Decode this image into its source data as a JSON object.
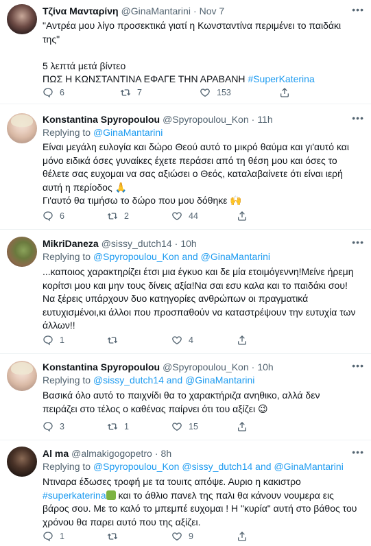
{
  "tweets": [
    {
      "name": "Τζίνα Μανταρίνη",
      "handle": "@GinaMantarini",
      "sep": "·",
      "time": "Nov 7",
      "lines": [
        "\"Αντρέα μου λίγο προσεκτικά γιατί η Κωνσταντίνα περιμένει το παιδάκι",
        "της\"",
        "",
        "5 λεπτά μετά βίντεο",
        "ΠΩΣ Η ΚΩΝΣΤΑΝΤΙΝΑ ΕΦΑΓΕ ΤΗΝ ΑΡΑΒΑΝΗ "
      ],
      "hashtag": "#SuperKaterina",
      "replies": "6",
      "retweets": "7",
      "likes": "153"
    },
    {
      "name": "Konstantina Spyropoulou",
      "handle": "@Spyropoulou_Kon",
      "sep": "·",
      "time": "11h",
      "replying_label": "Replying to ",
      "replying_to": "@GinaMantarini",
      "lines": [
        "Είναι μεγάλη ευλογία και δώρο Θεού αυτό το μικρό θαύμα και γι'αυτό και",
        "μόνο ειδικά όσες γυναίκες έχετε περάσει από τη θέση μου και όσες το",
        "θέλετε σας ευχομαι να σας αξιώσει ο Θεός, καταλαβαίνετε ότι είναι ιερή",
        "αυτή η περίοδος 🙏",
        "Γι'αυτό θα τιμήσω το δώρο που μου δόθηκε 🙌"
      ],
      "replies": "6",
      "retweets": "2",
      "likes": "44"
    },
    {
      "name": "MikriDaneza",
      "handle": "@sissy_dutch14",
      "sep": "·",
      "time": "10h",
      "replying_label": "Replying to ",
      "replying_to": "@Spyropoulou_Kon",
      "replying_and": " and ",
      "replying_to2": "@GinaMantarini",
      "lines": [
        "...καποιος χαρακτηρίζει έτσι μια έγκυο και δε μία ετοιμόγεννη!Μείνε ήρεμη",
        "κορίτσι μου  και μην τους δίνεις αξία!Να σαι εσυ καλα και το παιδάκι σου!",
        "Να ξέρεις υπάρχουν δυο κατηγορίες ανθρώπων οι πραγματικά",
        "ευτυχισμένοι,κι άλλοι που προσπαθούν να καταστρέψουν την ευτυχία των",
        "άλλων!!"
      ],
      "replies": "1",
      "retweets": "",
      "likes": "4"
    },
    {
      "name": "Konstantina Spyropoulou",
      "handle": "@Spyropoulou_Kon",
      "sep": "·",
      "time": "10h",
      "replying_label": "Replying to ",
      "replying_to": "@sissy_dutch14",
      "replying_and": " and ",
      "replying_to2": "@GinaMantarini",
      "lines": [
        "Βασικά όλο αυτό το παιχνίδι θα το χαρακτήριζα ανηθικο, αλλά δεν",
        "πειράζει στο τέλος ο καθένας παίρνει ότι του αξίζει 😉"
      ],
      "replies": "3",
      "retweets": "1",
      "likes": "15"
    },
    {
      "name": "Al ma",
      "handle": "@almakigogopetro",
      "sep": "·",
      "time": "8h",
      "replying_label": "Replying to ",
      "replying_to": "@Spyropoulou_Kon",
      "replying_to_b": "@sissy_dutch14",
      "replying_and": " and ",
      "replying_to2": "@GinaMantarini",
      "lines": [
        "Ντιναρα έδωσες τροφή με τα τουιτς απόψε. Αυριο η κακιστρο",
        " και το άθλιο πανελ της παλι θα κάνουν νουμερα εις",
        "βάρος σου. Με το καλό το μπεμπέ ευχομαι ! Η \"κυρία\" αυτή στο βάθος του",
        "χρόνου θα παρει αυτό που της αξίζει."
      ],
      "hashtag": "#superkaterina",
      "replies": "1",
      "retweets": "",
      "likes": "9"
    }
  ],
  "icons": [
    "reply-icon",
    "retweet-icon",
    "like-icon",
    "share-icon",
    "more-icon"
  ]
}
